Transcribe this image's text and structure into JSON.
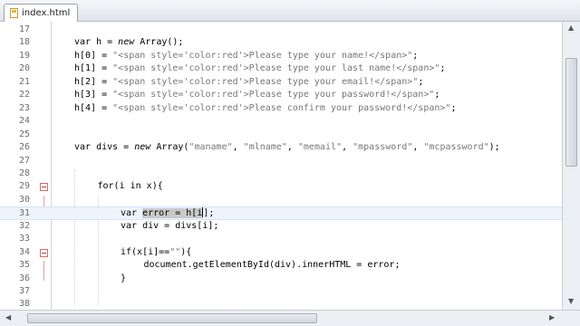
{
  "tab": {
    "label": "index.html",
    "icon": "html-file-icon"
  },
  "lines": [
    {
      "n": "17",
      "code": ""
    },
    {
      "n": "18",
      "code": "var h = new Array();"
    },
    {
      "n": "19",
      "code": "h[0] = \"<span style='color:red'>Please type your name!</span>\";"
    },
    {
      "n": "20",
      "code": "h[1] = \"<span style='color:red'>Please type your last name!</span>\";"
    },
    {
      "n": "21",
      "code": "h[2] = \"<span style='color:red'>Please type your email!</span>\";"
    },
    {
      "n": "22",
      "code": "h[3] = \"<span style='color:red'>Please type your password!</span>\";"
    },
    {
      "n": "23",
      "code": "h[4] = \"<span style='color:red'>Please confirm your password!</span>\";"
    },
    {
      "n": "24",
      "code": ""
    },
    {
      "n": "25",
      "code": ""
    },
    {
      "n": "26",
      "code": "var divs = new Array(\"maname\", \"mlname\", \"memail\", \"mpassword\", \"mcpassword\");"
    },
    {
      "n": "27",
      "code": ""
    },
    {
      "n": "28",
      "code": ""
    },
    {
      "n": "29",
      "code": "for(i in x){"
    },
    {
      "n": "30",
      "code": ""
    },
    {
      "n": "31",
      "code": "var error = h[i];"
    },
    {
      "n": "32",
      "code": "var div = divs[i];"
    },
    {
      "n": "33",
      "code": ""
    },
    {
      "n": "34",
      "code": "if(x[i]==\"\"){"
    },
    {
      "n": "35",
      "code": "document.getElementById(div).innerHTML = error;"
    },
    {
      "n": "36",
      "code": "}"
    },
    {
      "n": "37",
      "code": ""
    },
    {
      "n": "38",
      "code": ""
    }
  ]
}
